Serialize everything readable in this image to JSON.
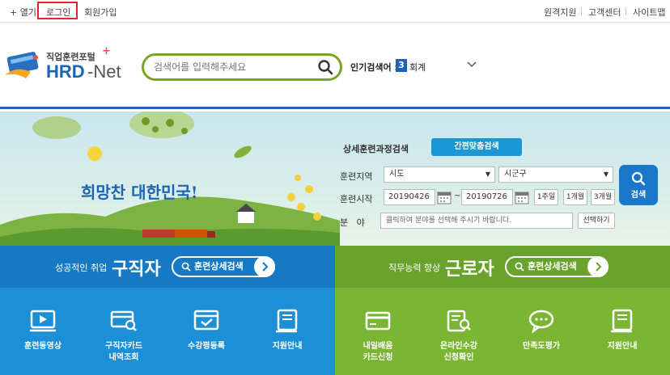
{
  "topbar": {
    "open": "+ 열기",
    "login": "로그인",
    "signup": "회원가입",
    "remote": "원격지원",
    "customer": "고객센터",
    "sitemap": "사이트맵"
  },
  "logo": {
    "subtitle": "직업훈련포털",
    "title_hrd": "HRD",
    "title_net": "-Net"
  },
  "search": {
    "placeholder": "검색어를 입력해주세요"
  },
  "popular": {
    "label": "인기검색어 :",
    "rank": "3",
    "keyword": "회계"
  },
  "banner": {
    "slogan": "희망찬 대한민국!"
  },
  "form": {
    "title": "상세훈련과정검색",
    "custom_button": "간편맞춤검색",
    "region_label": "훈련지역",
    "region_value": "시도",
    "district_value": "시군구",
    "date_label": "훈련시작",
    "date_from": "20190426",
    "tilde": "~",
    "date_to": "20190726",
    "period_1w": "1주일",
    "period_1m": "1개월",
    "period_3m": "3개월",
    "field_label": "분   야",
    "field_placeholder": "클릭하여 분야를 선택해 주시기 바랍니다.",
    "select_button": "선택하기",
    "search_button": "검색"
  },
  "job_seeker": {
    "sub": "성공적인 취업",
    "title": "구직자",
    "detail_button": "훈련상세검색",
    "items": [
      {
        "label": "훈련동영상"
      },
      {
        "label": "구직자카드\n내역조회"
      },
      {
        "label": "수강평등록"
      },
      {
        "label": "지원안내"
      }
    ]
  },
  "worker": {
    "sub": "직무능력 향상",
    "title": "근로자",
    "detail_button": "훈련상세검색",
    "items": [
      {
        "label": "내일배움\n카드신청"
      },
      {
        "label": "온라인수강\n신청확인"
      },
      {
        "label": "만족도평가"
      },
      {
        "label": "지원안내"
      }
    ]
  },
  "colors": {
    "brand_blue": "#1b64b3",
    "search_green": "#7aa428",
    "seeker_blue": "#1d8fd6",
    "worker_green": "#7bb534",
    "login_highlight": "#e0262b"
  }
}
